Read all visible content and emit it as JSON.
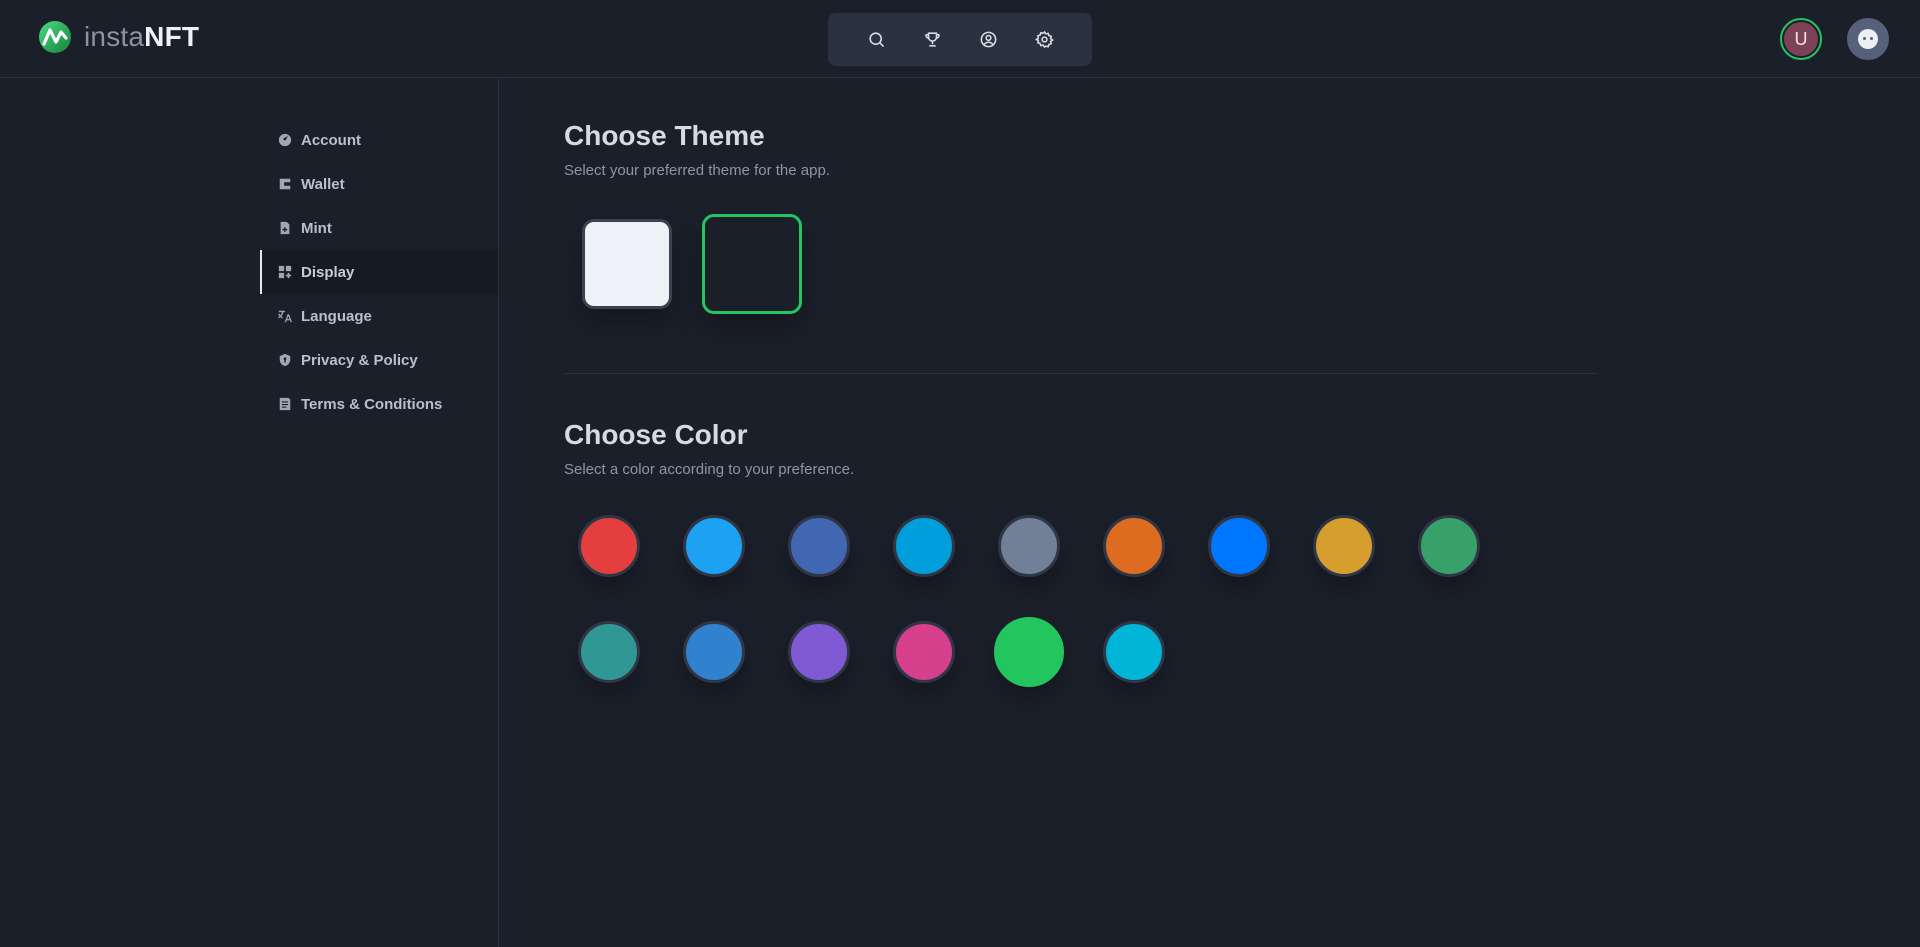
{
  "brand": {
    "name_light": "insta",
    "name_bold": "NFT"
  },
  "top_nav": {
    "icons": [
      "search-icon",
      "trophy-icon",
      "user-circle-icon",
      "gear-icon"
    ]
  },
  "user": {
    "initial": "U"
  },
  "sidebar": {
    "items": [
      {
        "label": "Account",
        "icon": "gauge-icon"
      },
      {
        "label": "Wallet",
        "icon": "wallet-icon"
      },
      {
        "label": "Mint",
        "icon": "file-plus-icon"
      },
      {
        "label": "Display",
        "icon": "grid-plus-icon",
        "active": true
      },
      {
        "label": "Language",
        "icon": "translate-icon"
      },
      {
        "label": "Privacy & Policy",
        "icon": "shield-icon"
      },
      {
        "label": "Terms & Conditions",
        "icon": "document-icon"
      }
    ]
  },
  "theme": {
    "title": "Choose Theme",
    "description": "Select your preferred theme for the app.",
    "options": [
      {
        "name": "light",
        "color": "#eef1f5",
        "selected": false
      },
      {
        "name": "dark",
        "color": "#1b1f2a",
        "selected": true
      }
    ]
  },
  "color": {
    "title": "Choose Color",
    "description": "Select a color according to your preference.",
    "swatches": [
      {
        "color": "#e53e3e",
        "selected": false
      },
      {
        "color": "#1da1f2",
        "selected": false
      },
      {
        "color": "#4267b2",
        "selected": false
      },
      {
        "color": "#009fdc",
        "selected": false
      },
      {
        "color": "#718096",
        "selected": false
      },
      {
        "color": "#dd6b20",
        "selected": false
      },
      {
        "color": "#0077ff",
        "selected": false
      },
      {
        "color": "#d69e2e",
        "selected": false
      },
      {
        "color": "#38a169",
        "selected": false
      },
      {
        "color": "#319795",
        "selected": false
      },
      {
        "color": "#3182ce",
        "selected": false
      },
      {
        "color": "#805ad5",
        "selected": false
      },
      {
        "color": "#d53f8c",
        "selected": false
      },
      {
        "color": "#22c55e",
        "selected": true
      },
      {
        "color": "#00b5d8",
        "selected": false
      }
    ],
    "accent": "#22c55e"
  }
}
